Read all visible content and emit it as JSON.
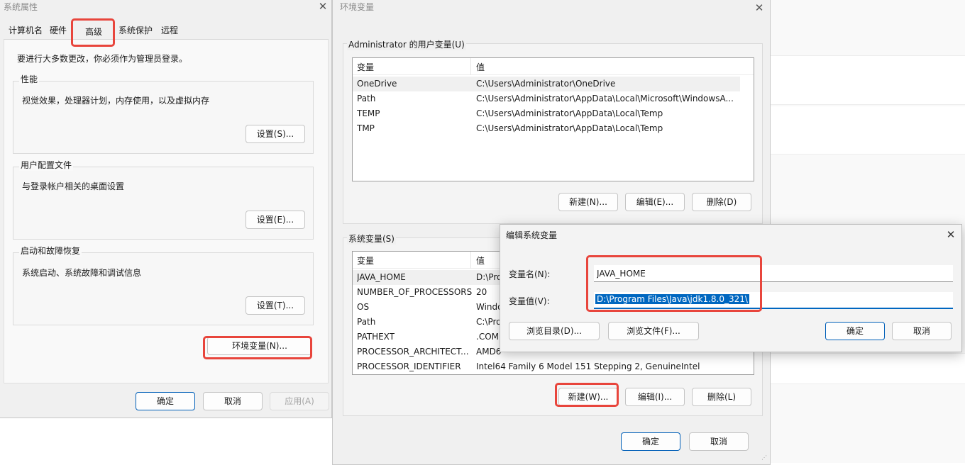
{
  "sysprops": {
    "title": "系统属性",
    "tabs": [
      "计算机名",
      "硬件",
      "高级",
      "系统保护",
      "远程"
    ],
    "admin_note": "要进行大多数更改，你必须作为管理员登录。",
    "performance": {
      "label": "性能",
      "desc": "视觉效果，处理器计划，内存使用，以及虚拟内存",
      "button": "设置(S)..."
    },
    "profiles": {
      "label": "用户配置文件",
      "desc": "与登录帐户相关的桌面设置",
      "button": "设置(E)..."
    },
    "startup": {
      "label": "启动和故障恢复",
      "desc": "系统启动、系统故障和调试信息",
      "button": "设置(T)..."
    },
    "env_button": "环境变量(N)...",
    "ok": "确定",
    "cancel": "取消",
    "apply": "应用(A)"
  },
  "envvars": {
    "title": "环境变量",
    "user_group": "Administrator 的用户变量(U)",
    "col_var": "变量",
    "col_val": "值",
    "user_rows": [
      {
        "name": "OneDrive",
        "value": "C:\\Users\\Administrator\\OneDrive"
      },
      {
        "name": "Path",
        "value": "C:\\Users\\Administrator\\AppData\\Local\\Microsoft\\WindowsA..."
      },
      {
        "name": "TEMP",
        "value": "C:\\Users\\Administrator\\AppData\\Local\\Temp"
      },
      {
        "name": "TMP",
        "value": "C:\\Users\\Administrator\\AppData\\Local\\Temp"
      }
    ],
    "user_new": "新建(N)...",
    "user_edit": "编辑(E)...",
    "user_delete": "删除(D)",
    "sys_group": "系统变量(S)",
    "sys_rows": [
      {
        "name": "JAVA_HOME",
        "value": "D:\\Pro"
      },
      {
        "name": "NUMBER_OF_PROCESSORS",
        "value": "20"
      },
      {
        "name": "OS",
        "value": "Windo"
      },
      {
        "name": "Path",
        "value": "C:\\Pro"
      },
      {
        "name": "PATHEXT",
        "value": ".COM"
      },
      {
        "name": "PROCESSOR_ARCHITECT...",
        "value": "AMD6"
      },
      {
        "name": "PROCESSOR_IDENTIFIER",
        "value": "Intel64 Family 6 Model 151 Stepping 2, GenuineIntel"
      }
    ],
    "sys_new": "新建(W)...",
    "sys_edit": "编辑(I)...",
    "sys_delete": "删除(L)",
    "ok": "确定",
    "cancel": "取消"
  },
  "editdlg": {
    "title": "编辑系统变量",
    "name_label": "变量名(N):",
    "name_value": "JAVA_HOME",
    "value_label": "变量值(V):",
    "value_value": "D:\\Program Files\\Java\\jdk1.8.0_321\\",
    "browse_dir": "浏览目录(D)...",
    "browse_file": "浏览文件(F)...",
    "ok": "确定",
    "cancel": "取消"
  },
  "colors": {
    "highlight": "#e8453c",
    "selection": "#0067c0",
    "primary_border": "#005fb8"
  }
}
